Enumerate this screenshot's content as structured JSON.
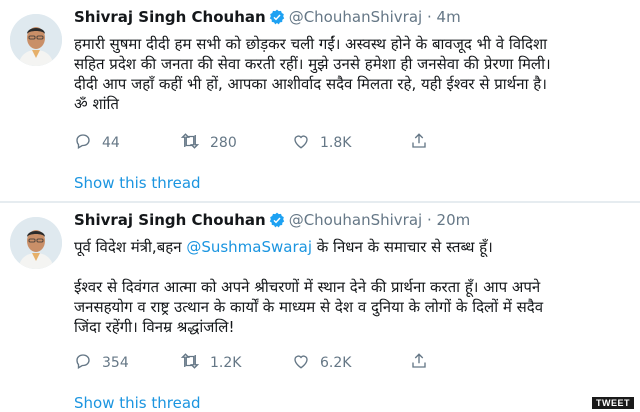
{
  "tweets": [
    {
      "name": "Shivraj Singh Chouhan",
      "handle": "@ChouhanShivraj",
      "separator": "·",
      "time": "4m",
      "text_lines": [
        "हमारी सुषमा दीदी हम सभी को छोड़कर चली गईं। अस्वस्थ होने के बावजूद भी वे विदिशा",
        "सहित प्रदेश की जनता की सेवा करती रहीं। मुझे उनसे हमेशा ही जनसेवा की प्रेरणा मिली।",
        "दीदी आप जहाँ कहीं भी हों, आपका आशीर्वाद सदैव मिलता रहे, यही ईश्वर से प्रार्थना है।",
        "ॐ शांति"
      ],
      "replies": "44",
      "retweets": "280",
      "likes": "1.8K",
      "thread_link": "Show this thread"
    },
    {
      "name": "Shivraj Singh Chouhan",
      "handle": "@ChouhanShivraj",
      "separator": "·",
      "time": "20m",
      "text_line1_before": "पूर्व विदेश मंत्री,बहन ",
      "text_mention": "@SushmaSwaraj",
      "text_line1_after": " के निधन के समाचार से स्तब्ध हूँ।",
      "text_lines": [
        "ईश्वर से दिवंगत आत्मा को अपने श्रीचरणों में स्थान देने की प्रार्थना करता हूँ। आप अपने",
        "जनसहयोग व राष्ट्र उत्थान के कार्यों के माध्यम से देश व दुनिया के लोगों के दिलों में सदैव",
        "जिंदा रहेंगी। विनम्र श्रद्धांजलि!"
      ],
      "replies": "354",
      "retweets": "1.2K",
      "likes": "6.2K",
      "thread_link": "Show this thread"
    }
  ],
  "badge": "TWEET",
  "colors": {
    "link": "#1b95e0",
    "muted": "#657786",
    "text": "#14171a"
  },
  "icons": [
    "avatar",
    "verified-badge-icon",
    "reply-icon",
    "retweet-icon",
    "like-icon",
    "share-icon"
  ]
}
